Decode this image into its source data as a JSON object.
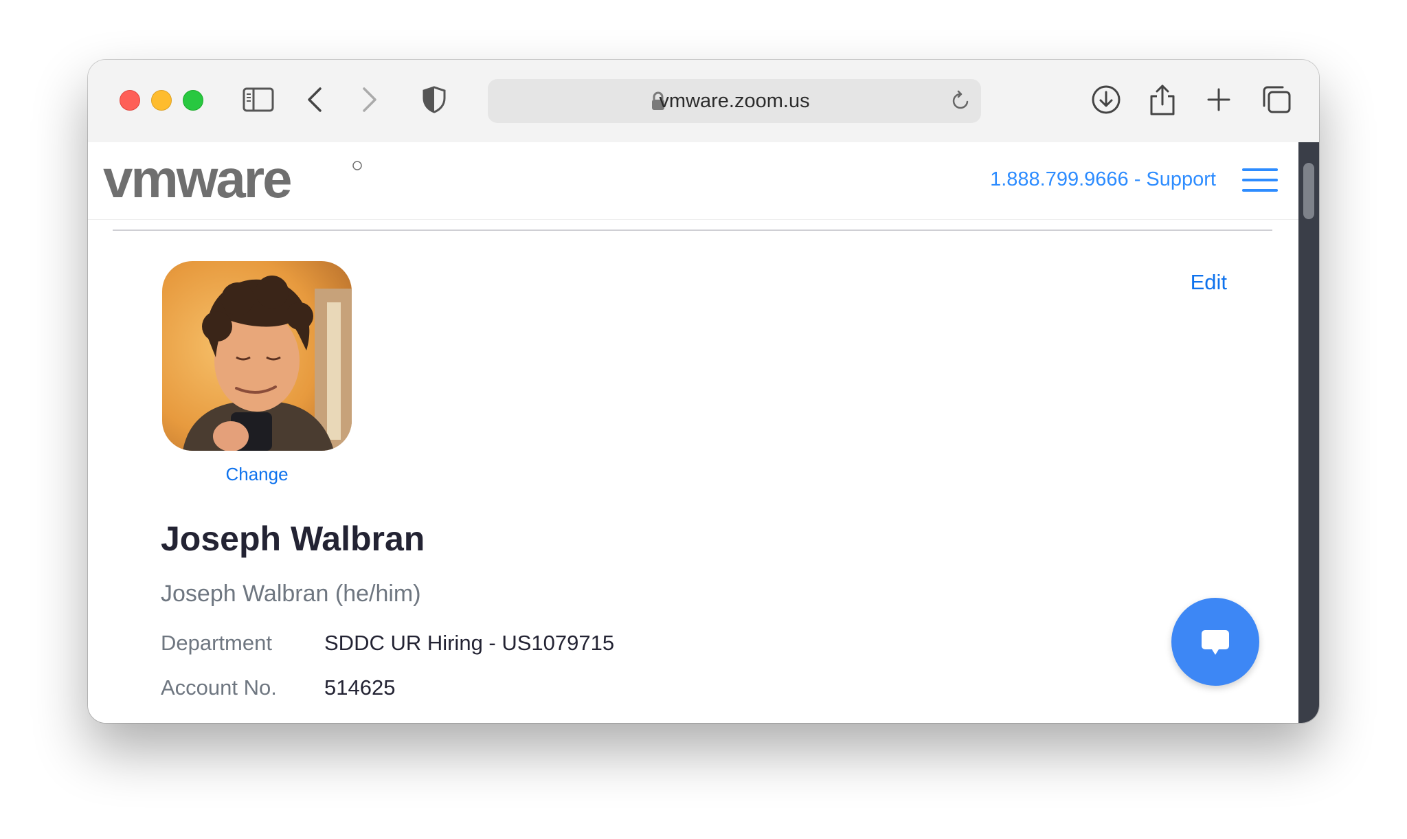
{
  "browser": {
    "url": "vmware.zoom.us",
    "icons": [
      "sidebar-icon",
      "back-icon",
      "forward-icon",
      "privacy-shield-icon",
      "lock-icon",
      "reload-icon",
      "download-icon",
      "share-icon",
      "new-tab-icon",
      "tab-overview-icon"
    ]
  },
  "header": {
    "logo_text": "vmware",
    "support_text": "1.888.799.9666 - Support",
    "accent_color": "#2d8cff"
  },
  "profile": {
    "change_label": "Change",
    "edit_label": "Edit",
    "name": "Joseph Walbran",
    "display_name": "Joseph Walbran (he/him)",
    "fields": [
      {
        "label": "Department",
        "value": "SDDC UR Hiring - US1079715"
      },
      {
        "label": "Account No.",
        "value": "514625"
      }
    ]
  },
  "chat": {
    "icon": "chat-bubble-icon",
    "color": "#3d87f5"
  }
}
